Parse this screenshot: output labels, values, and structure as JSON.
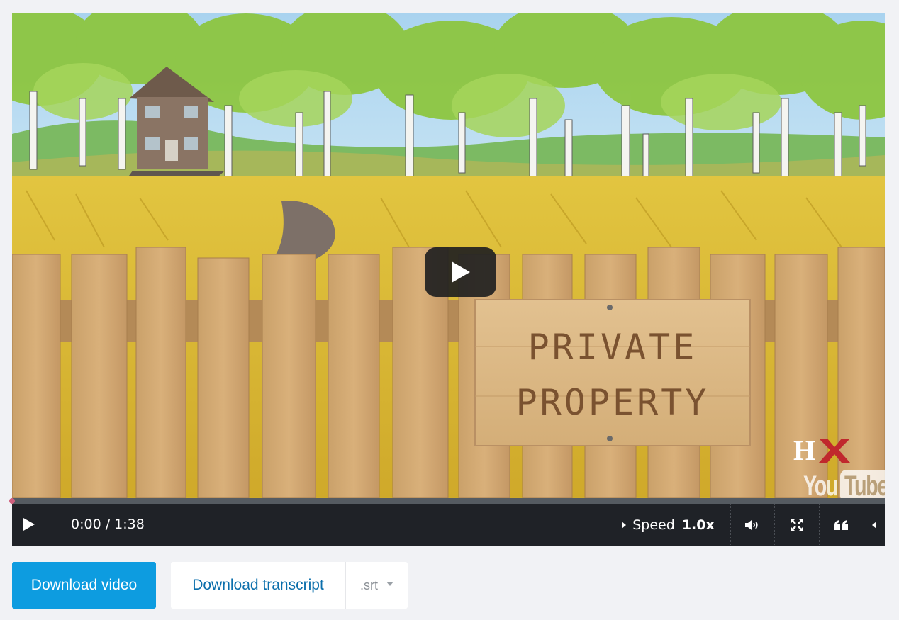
{
  "video": {
    "sign_line1": "PRIVATE",
    "sign_line2": "PROPERTY",
    "brand_hx_left": "H",
    "brand_youtube_you": "You",
    "brand_youtube_tube": "Tube",
    "progress_fraction": 0.0
  },
  "controls": {
    "time": "0:00 / 1:38",
    "speed_label": "Speed",
    "speed_value": "1.0x",
    "icons": {
      "play": "play-icon",
      "volume": "volume-icon",
      "fullscreen": "fullscreen-icon",
      "captions": "quote-captions-icon",
      "more": "caret-left-icon"
    }
  },
  "actions": {
    "download_video": "Download video",
    "download_transcript": "Download transcript",
    "transcript_format": ".srt"
  },
  "colors": {
    "primary_button": "#0d9ce0",
    "link": "#0b6fac",
    "control_bar": "#1f2227",
    "progress_handle": "#d0607e",
    "page_background": "#f1f2f5"
  }
}
